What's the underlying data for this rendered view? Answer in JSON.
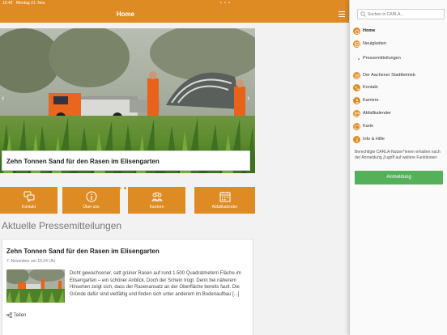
{
  "status_bar": {
    "time": "15:42",
    "date": "Montag 21. Nov."
  },
  "nav": {
    "title": "Home"
  },
  "hero": {
    "caption": "Zehn Tonnen Sand für den Rasen im Elisengarten",
    "slides": 3,
    "active_slide": 2
  },
  "tiles": [
    {
      "label": "Kontakt",
      "icon": "chat-icon"
    },
    {
      "label": "Über uns",
      "icon": "info-icon"
    },
    {
      "label": "Karriere",
      "icon": "people-icon"
    },
    {
      "label": "Abfallkalender",
      "icon": "calendar-icon"
    }
  ],
  "press": {
    "section_title": "Aktuelle Pressemitteilungen",
    "article": {
      "title": "Zehn Tonnen Sand für den Rasen im Elisengarten",
      "date": "7. November um 15:24 Uhr",
      "body": "Dicht gewachsener, satt grüner Rasen auf rund 1.500 Quadratmetern Fläche im Elisengarten – ein schöner Anblick. Doch der Schein trügt. Denn bei näherem Hinsehen zeigt sich, dass der Rasenansatz an der Oberfläche bereits fault. Die Gründe dafür sind vielfältig und finden sich unter anderem im Bodenaufbau [...]",
      "share_label": "Teilen"
    }
  },
  "sidebar": {
    "search_placeholder": "Suchen in CARLA...",
    "items": {
      "home": "Home",
      "news": "Neuigkeiten",
      "press": "Pressemitteilungen",
      "aachener": "Der Aachener Stadtbetrieb",
      "kontakt": "Kontakt",
      "karriere": "Karriere",
      "abfall": "Abfallkalender",
      "karte": "Karte",
      "info": "Info & Hilfe"
    },
    "info_text": "Berechtigte CARLA-Nutzer*innen erhalten nach der Anmeldung Zugriff auf weitere Funktionen:",
    "login_label": "Anmeldung"
  },
  "colors": {
    "accent": "#de8b24",
    "login": "#55b05a"
  }
}
